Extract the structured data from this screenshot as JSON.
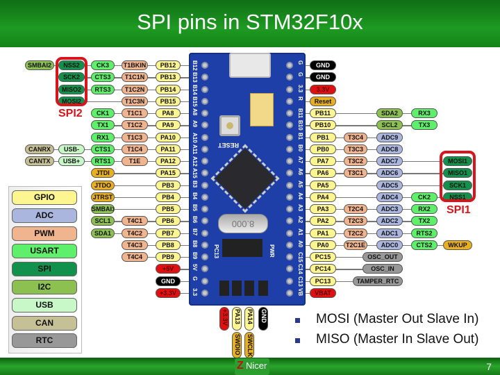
{
  "title": "SPI pins in STM32F10x",
  "page_number": "7",
  "logo_text": "Nicer",
  "colors": {
    "gpio": "#fdf590",
    "adc": "#aab6de",
    "pwm": "#f0b48e",
    "usart": "#5ef06a",
    "spi": "#12914c",
    "i2c": "#8cc050",
    "usb": "#c8f8c8",
    "can": "#c6c096",
    "rtc": "#989898",
    "jtag": "#e8b020",
    "power": "#e01010",
    "gnd": "#000000"
  },
  "legend": [
    {
      "label": "GPIO",
      "kind": "gpio"
    },
    {
      "label": "ADC",
      "kind": "adc"
    },
    {
      "label": "PWM",
      "kind": "pwm"
    },
    {
      "label": "USART",
      "kind": "usart"
    },
    {
      "label": "SPI",
      "kind": "spi"
    },
    {
      "label": "I2C",
      "kind": "i2c"
    },
    {
      "label": "USB",
      "kind": "usb"
    },
    {
      "label": "CAN",
      "kind": "can"
    },
    {
      "label": "RTC",
      "kind": "rtc"
    }
  ],
  "left_rows": [
    [
      [
        "SMBAI2",
        "i2c"
      ],
      [
        "NSS2",
        "spi"
      ],
      [
        "CK3",
        "usart"
      ],
      [
        "T1BKIN",
        "pwm"
      ],
      [
        "PB12",
        "gpio"
      ]
    ],
    [
      null,
      [
        "SCK2",
        "spi"
      ],
      [
        "CTS3",
        "usart"
      ],
      [
        "T1C1N",
        "pwm"
      ],
      [
        "PB13",
        "gpio"
      ]
    ],
    [
      null,
      [
        "MISO2",
        "spi"
      ],
      [
        "RTS3",
        "usart"
      ],
      [
        "T1C2N",
        "pwm"
      ],
      [
        "PB14",
        "gpio"
      ]
    ],
    [
      null,
      [
        "MOSI2",
        "spi"
      ],
      null,
      [
        "T1C3N",
        "pwm"
      ],
      [
        "PB15",
        "gpio"
      ]
    ],
    [
      null,
      null,
      [
        "CK1",
        "usart"
      ],
      [
        "T1C1",
        "pwm"
      ],
      [
        "PA8",
        "gpio"
      ]
    ],
    [
      null,
      null,
      [
        "TX1",
        "usart"
      ],
      [
        "T1C2",
        "pwm"
      ],
      [
        "PA9",
        "gpio"
      ]
    ],
    [
      null,
      null,
      [
        "RX1",
        "usart"
      ],
      [
        "T1C3",
        "pwm"
      ],
      [
        "PA10",
        "gpio"
      ]
    ],
    [
      [
        "CANRX",
        "can"
      ],
      [
        "USB-",
        "usb"
      ],
      [
        "CTS1",
        "usart"
      ],
      [
        "T1C4",
        "pwm"
      ],
      [
        "PA11",
        "gpio"
      ]
    ],
    [
      [
        "CANTX",
        "can"
      ],
      [
        "USB+",
        "usb"
      ],
      [
        "RTS1",
        "usart"
      ],
      [
        "T1E",
        "pwm"
      ],
      [
        "PA12",
        "gpio"
      ]
    ],
    [
      null,
      null,
      [
        "JTDI",
        "jtag"
      ],
      null,
      [
        "PA15",
        "gpio"
      ]
    ],
    [
      null,
      null,
      [
        "JTDO",
        "jtag"
      ],
      null,
      [
        "PB3",
        "gpio"
      ]
    ],
    [
      null,
      null,
      [
        "JTRST",
        "jtag"
      ],
      null,
      [
        "PB4",
        "gpio"
      ]
    ],
    [
      null,
      null,
      [
        "SMBAI1",
        "i2c"
      ],
      null,
      [
        "PB5",
        "gpio"
      ]
    ],
    [
      null,
      null,
      [
        "SCL1",
        "i2c"
      ],
      [
        "T4C1",
        "pwm"
      ],
      [
        "PB6",
        "gpio"
      ]
    ],
    [
      null,
      null,
      [
        "SDA1",
        "i2c"
      ],
      [
        "T4C2",
        "pwm"
      ],
      [
        "PB7",
        "gpio"
      ]
    ],
    [
      null,
      null,
      null,
      [
        "T4C3",
        "pwm"
      ],
      [
        "PB8",
        "gpio"
      ]
    ],
    [
      null,
      null,
      null,
      [
        "T4C4",
        "pwm"
      ],
      [
        "PB9",
        "gpio"
      ]
    ],
    [
      null,
      null,
      null,
      null,
      [
        "+5V",
        "power"
      ]
    ],
    [
      null,
      null,
      null,
      null,
      [
        "GND",
        "gnd"
      ]
    ],
    [
      null,
      null,
      null,
      null,
      [
        "+3.3V",
        "power"
      ]
    ]
  ],
  "right_rows": [
    [
      [
        "GND",
        "gnd"
      ]
    ],
    [
      [
        "GND",
        "gnd"
      ]
    ],
    [
      [
        "3.3V",
        "power"
      ]
    ],
    [
      [
        "Reset",
        "jtag"
      ]
    ],
    [
      [
        "PB11",
        "gpio"
      ],
      null,
      [
        "SDA2",
        "i2c"
      ],
      [
        "RX3",
        "usart"
      ]
    ],
    [
      [
        "PB10",
        "gpio"
      ],
      null,
      [
        "SCL2",
        "i2c"
      ],
      [
        "TX3",
        "usart"
      ]
    ],
    [
      [
        "PB1",
        "gpio"
      ],
      [
        "T3C4",
        "pwm"
      ],
      [
        "ADC9",
        "adc"
      ]
    ],
    [
      [
        "PB0",
        "gpio"
      ],
      [
        "T3C3",
        "pwm"
      ],
      [
        "ADC8",
        "adc"
      ]
    ],
    [
      [
        "PA7",
        "gpio"
      ],
      [
        "T3C2",
        "pwm"
      ],
      [
        "ADC7",
        "adc"
      ],
      null,
      [
        "MOSI1",
        "spi"
      ]
    ],
    [
      [
        "PA6",
        "gpio"
      ],
      [
        "T3C1",
        "pwm"
      ],
      [
        "ADC6",
        "adc"
      ],
      null,
      [
        "MISO1",
        "spi"
      ]
    ],
    [
      [
        "PA5",
        "gpio"
      ],
      null,
      [
        "ADC5",
        "adc"
      ],
      null,
      [
        "SCK1",
        "spi"
      ]
    ],
    [
      [
        "PA4",
        "gpio"
      ],
      null,
      [
        "ADC4",
        "adc"
      ],
      [
        "CK2",
        "usart"
      ],
      [
        "NSS1",
        "spi"
      ]
    ],
    [
      [
        "PA3",
        "gpio"
      ],
      [
        "T2C4",
        "pwm"
      ],
      [
        "ADC3",
        "adc"
      ],
      [
        "RX2",
        "usart"
      ]
    ],
    [
      [
        "PA2",
        "gpio"
      ],
      [
        "T2C3",
        "pwm"
      ],
      [
        "ADC2",
        "adc"
      ],
      [
        "TX2",
        "usart"
      ]
    ],
    [
      [
        "PA1",
        "gpio"
      ],
      [
        "T2C2",
        "pwm"
      ],
      [
        "ADC1",
        "adc"
      ],
      [
        "RTS2",
        "usart"
      ]
    ],
    [
      [
        "PA0",
        "gpio"
      ],
      [
        "T2C1E",
        "pwm"
      ],
      [
        "ADC0",
        "adc"
      ],
      [
        "CTS2",
        "usart"
      ],
      [
        "WKUP",
        "jtag"
      ]
    ],
    [
      [
        "PC15",
        "gpio"
      ],
      [
        "OSC_OUT",
        "rtc"
      ]
    ],
    [
      [
        "PC14",
        "gpio"
      ],
      [
        "OSC_IN",
        "rtc"
      ]
    ],
    [
      [
        "PC13",
        "gpio"
      ],
      [
        "TAMPER_RTC",
        "rtc"
      ]
    ],
    [
      [
        "VBAT",
        "power"
      ]
    ]
  ],
  "board": {
    "left_labels": [
      "B12",
      "B13",
      "B14",
      "B15",
      "A8",
      "A9",
      "A10",
      "A11",
      "A12",
      "A15",
      "B3",
      "B4",
      "B5",
      "B6",
      "B7",
      "B8",
      "B9",
      "5V",
      "G",
      "3.3"
    ],
    "right_labels": [
      "G",
      "G",
      "3.3",
      "R",
      "B11",
      "B10",
      "B1",
      "B0",
      "A7",
      "A6",
      "A5",
      "A4",
      "A3",
      "A2",
      "A1",
      "A0",
      "C15",
      "C14",
      "C13",
      "VB"
    ],
    "reset_label": "RESET",
    "crystal_label": "8.000",
    "pc13_label": "PC13",
    "pwr_label": "PWR"
  },
  "swd_header": [
    {
      "label": "+3.3V",
      "kind": "power",
      "sub": null
    },
    {
      "label": "PA13",
      "kind": "gpio",
      "sub": "SWDIO"
    },
    {
      "label": "PA14",
      "kind": "gpio",
      "sub": "SWCLK"
    },
    {
      "label": "GND",
      "kind": "gnd",
      "sub": null
    }
  ],
  "spi_groups": {
    "spi2": "SPI2",
    "spi1": "SPI1"
  },
  "bullets": [
    "MOSI (Master Out Slave In)",
    "MISO (Master In Slave Out)"
  ]
}
